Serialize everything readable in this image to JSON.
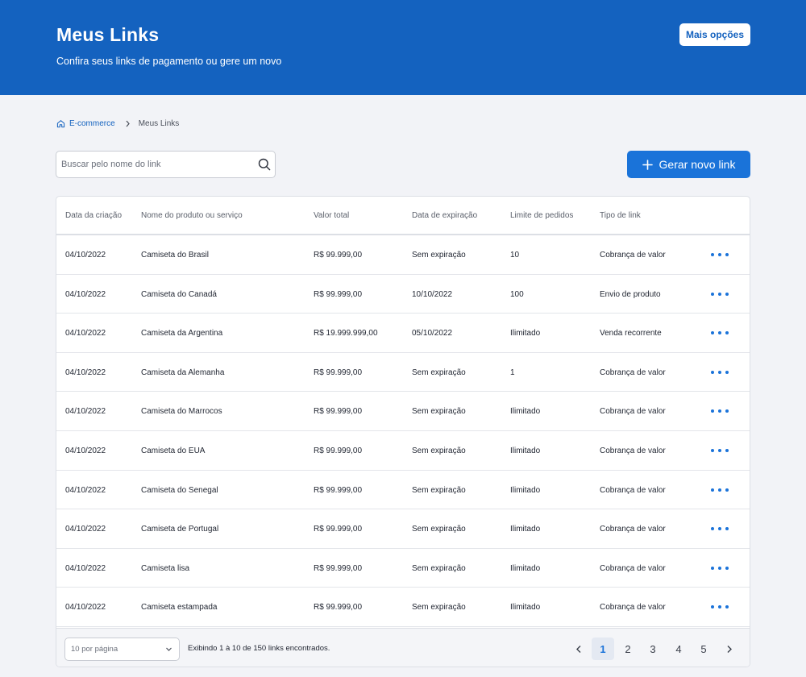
{
  "header": {
    "title": "Meus Links",
    "subtitle": "Confira seus links de pagamento ou gere um novo",
    "more_options_label": "Mais opções"
  },
  "breadcrumb": {
    "home_label": "E-commerce",
    "current_label": "Meus Links"
  },
  "search": {
    "placeholder": "Buscar pelo nome do link",
    "value": ""
  },
  "actions": {
    "generate_label": "Gerar novo link"
  },
  "table": {
    "columns": [
      "Data da criação",
      "Nome do produto ou serviço",
      "Valor total",
      "Data de expiração",
      "Limite de pedidos",
      "Tipo de link"
    ],
    "rows": [
      [
        "04/10/2022",
        "Camiseta do Brasil",
        "R$ 99.999,00",
        "Sem expiração",
        "10",
        "Cobrança de valor"
      ],
      [
        "04/10/2022",
        "Camiseta do Canadá",
        "R$ 99.999,00",
        "10/10/2022",
        "100",
        "Envio de produto"
      ],
      [
        "04/10/2022",
        "Camiseta da Argentina",
        "R$ 19.999.999,00",
        "05/10/2022",
        "Ilimitado",
        "Venda recorrente"
      ],
      [
        "04/10/2022",
        "Camiseta da Alemanha",
        "R$ 99.999,00",
        "Sem expiração",
        "1",
        "Cobrança de valor"
      ],
      [
        "04/10/2022",
        "Camiseta do Marrocos",
        "R$ 99.999,00",
        "Sem expiração",
        "Ilimitado",
        "Cobrança de valor"
      ],
      [
        "04/10/2022",
        "Camiseta do EUA",
        "R$ 99.999,00",
        "Sem expiração",
        "Ilimitado",
        "Cobrança de valor"
      ],
      [
        "04/10/2022",
        "Camiseta do Senegal",
        "R$ 99.999,00",
        "Sem expiração",
        "Ilimitado",
        "Cobrança de valor"
      ],
      [
        "04/10/2022",
        "Camiseta de Portugal",
        "R$ 99.999,00",
        "Sem expiração",
        "Ilimitado",
        "Cobrança de valor"
      ],
      [
        "04/10/2022",
        "Camiseta lisa",
        "R$ 99.999,00",
        "Sem expiração",
        "Ilimitado",
        "Cobrança de valor"
      ],
      [
        "04/10/2022",
        "Camiseta estampada",
        "R$ 99.999,00",
        "Sem expiração",
        "Ilimitado",
        "Cobrança de valor"
      ]
    ]
  },
  "footer": {
    "per_page_label": "10 por página",
    "showing_text": "Exibindo 1 à 10 de 150 links encontrados.",
    "pages": [
      "1",
      "2",
      "3",
      "4",
      "5"
    ],
    "current_page": "1"
  },
  "colors": {
    "header_bg": "#1462bf",
    "primary": "#1a73d9",
    "page_bg": "#f2f3f7"
  },
  "icons": {
    "home": "home-icon",
    "breadcrumb_separator": "chevron-right-icon",
    "search": "search-icon",
    "generate": "plus-icon",
    "row_actions": "more-horizontal-icon",
    "per_page": "chevron-down-icon",
    "prev_page": "chevron-left-icon",
    "next_page": "chevron-right-icon"
  }
}
